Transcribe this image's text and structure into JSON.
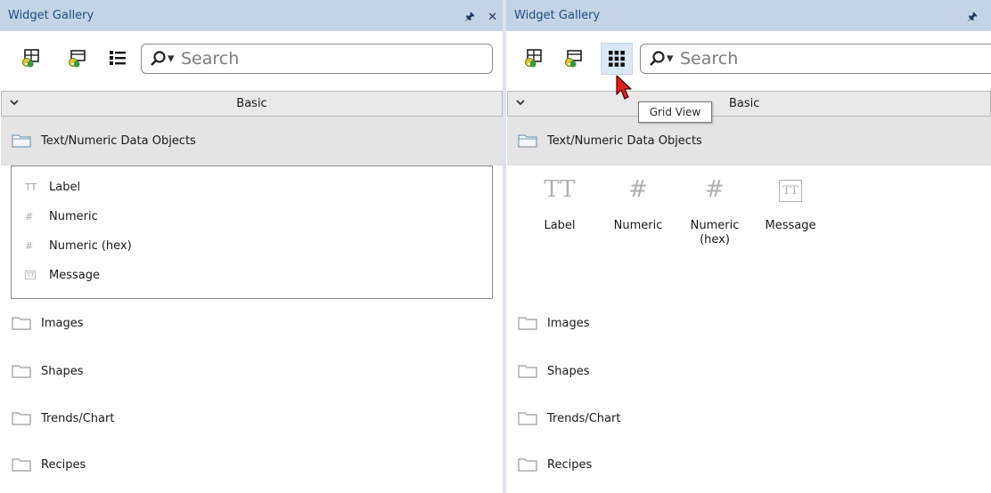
{
  "left": {
    "title": "Widget Gallery",
    "pin_icon": "pin-icon",
    "close_icon": "close-icon",
    "toolbar": {
      "tools": [
        "add-widget-icon",
        "edit-widget-icon",
        "list-view-icon"
      ]
    },
    "search": {
      "placeholder": "Search"
    },
    "group": {
      "label": "Basic"
    },
    "open_category": {
      "label": "Text/Numeric Data Objects",
      "items": [
        {
          "label": "Label",
          "icon": "tt-icon"
        },
        {
          "label": "Numeric",
          "icon": "hash-icon"
        },
        {
          "label": "Numeric (hex)",
          "icon": "hash-icon"
        },
        {
          "label": "Message",
          "icon": "message-icon"
        }
      ]
    },
    "categories": [
      "Images",
      "Shapes",
      "Trends/Chart",
      "Recipes"
    ]
  },
  "right": {
    "title": "Widget Gallery",
    "toolbar": {
      "tools": [
        "add-widget-icon",
        "edit-widget-icon",
        "grid-view-icon"
      ],
      "active": "grid-view-icon"
    },
    "search": {
      "placeholder": "Search"
    },
    "group": {
      "label": "Basic"
    },
    "tooltip": "Grid View",
    "open_category": {
      "label": "Text/Numeric Data Objects",
      "grid_items": [
        {
          "label": "Label",
          "glyph": "TT"
        },
        {
          "label": "Numeric",
          "glyph": "#"
        },
        {
          "label": "Numeric (hex)",
          "glyph": "#"
        },
        {
          "label": "Message",
          "glyph": "TT"
        }
      ]
    },
    "categories": [
      "Images",
      "Shapes",
      "Trends/Chart",
      "Recipes"
    ]
  },
  "colors": {
    "titlebar": "#c4d3e6",
    "title_text": "#1f4e86",
    "group_bg": "#e9e9e9",
    "open_category_bg": "#e4e4e4"
  }
}
